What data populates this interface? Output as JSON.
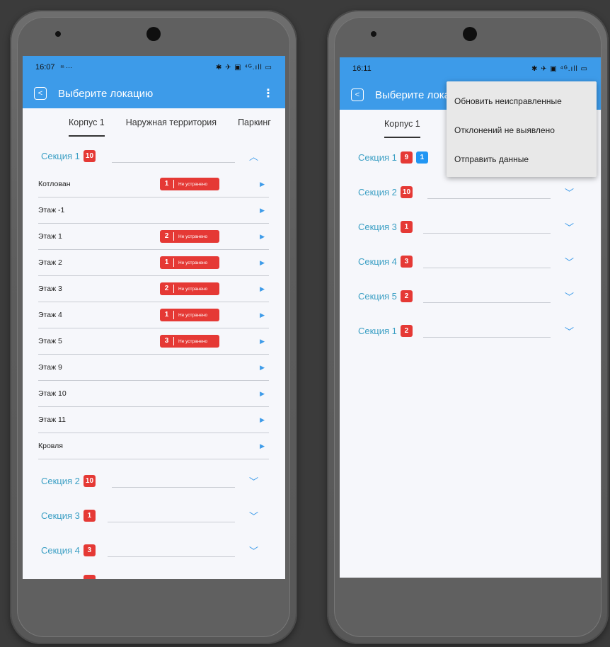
{
  "left": {
    "status_time": "16:07",
    "status_extra": "ᵐ ···",
    "status_icons": "✱ ✈ ▣ ⁴ᴳ.ıll ▭",
    "title": "Выберите локацию",
    "tabs": [
      "Корпус 1",
      "Наружная территория",
      "Паркинг"
    ],
    "sections_top": [
      {
        "label": "Секция 1",
        "count": "10"
      }
    ],
    "rows": [
      {
        "label": "Котлован",
        "count": "1",
        "status": "Не устранено"
      },
      {
        "label": "Этаж -1"
      },
      {
        "label": "Этаж 1",
        "count": "2",
        "status": "Не устранено"
      },
      {
        "label": "Этаж 2",
        "count": "1",
        "status": "Не устранено"
      },
      {
        "label": "Этаж 3",
        "count": "2",
        "status": "Не устранено"
      },
      {
        "label": "Этаж 4",
        "count": "1",
        "status": "Не устранено"
      },
      {
        "label": "Этаж 5",
        "count": "3",
        "status": "Не устранено"
      },
      {
        "label": "Этаж 9"
      },
      {
        "label": "Этаж 10"
      },
      {
        "label": "Этаж 11"
      },
      {
        "label": "Кровля"
      }
    ],
    "sections_bottom": [
      {
        "label": "Секция 2",
        "count": "10"
      },
      {
        "label": "Секция 3",
        "count": "1"
      },
      {
        "label": "Секция 4",
        "count": "3"
      }
    ]
  },
  "right": {
    "status_time": "16:11",
    "status_icons": "✱ ✈ ▣ ⁴ᴳ.ıll ▭",
    "title": "Выберите лока",
    "tabs": [
      "Корпус 1"
    ],
    "sections": [
      {
        "label": "Секция 1",
        "count": "9",
        "count2": "1"
      },
      {
        "label": "Секция 2",
        "count": "10"
      },
      {
        "label": "Секция 3",
        "count": "1"
      },
      {
        "label": "Секция 4",
        "count": "3"
      },
      {
        "label": "Секция 5",
        "count": "2"
      },
      {
        "label": "Секция 1",
        "count": "2"
      }
    ],
    "menu": [
      "Обновить неисправленные",
      "Отклонений не выявлено",
      "Отправить данные"
    ]
  },
  "colors": {
    "accent": "#3d9be9",
    "badge_red": "#e53935",
    "badge_blue": "#2196f3",
    "section_text": "#3b9fc4"
  },
  "icons": [
    "back-icon",
    "kebab-menu-icon",
    "chevron-up-icon",
    "chevron-down-icon",
    "arrow-right-icon"
  ]
}
